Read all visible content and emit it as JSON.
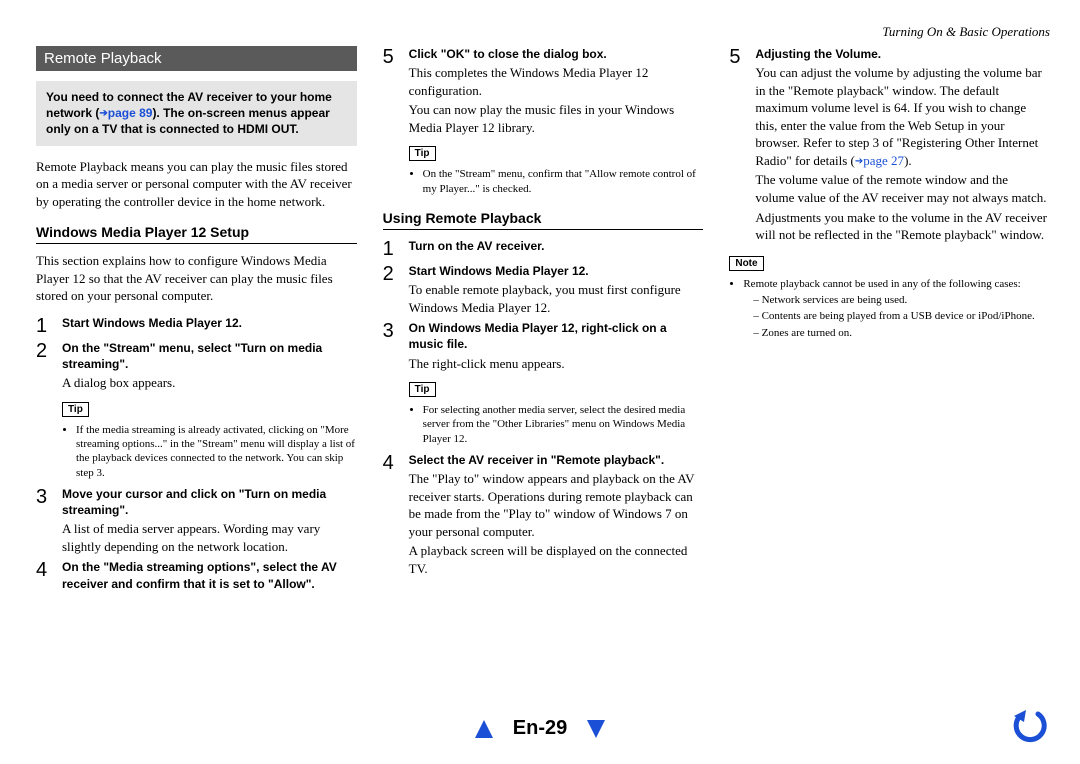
{
  "breadcrumb": "Turning On & Basic Operations",
  "section_title": "Remote Playback",
  "notice": {
    "part1": "You need to connect the AV receiver to your home network (",
    "link": "page 89",
    "part2": "). The on-screen menus appear only on a TV that is connected to ",
    "bold_end": "HDMI OUT",
    "tail": "."
  },
  "intro": "Remote Playback means you can play the music files stored on a media server or personal computer with the AV receiver by operating the controller device in the home network.",
  "wmp_heading": "Windows Media Player 12 Setup",
  "wmp_intro": "This section explains how to configure Windows Media Player 12 so that the AV receiver can play the music files stored on your personal computer.",
  "wmp_steps": {
    "s1": {
      "num": "1",
      "lead": "Start Windows Media Player 12."
    },
    "s2": {
      "num": "2",
      "lead": "On the \"Stream\" menu, select \"Turn on media streaming\".",
      "follow": "A dialog box appears."
    },
    "s2_tip_label": "Tip",
    "s2_tip_bullet": "If the media streaming is already activated, clicking on \"More streaming options...\" in the \"Stream\" menu will display a list of the playback devices connected to the network. You can skip step 3.",
    "s3": {
      "num": "3",
      "lead": "Move your cursor and click on \"Turn on media streaming\".",
      "follow": "A list of media server appears. Wording may vary slightly depending on the network location."
    },
    "s4": {
      "num": "4",
      "lead": "On the \"Media streaming options\", select the AV receiver and confirm that it is set to \"Allow\"."
    },
    "s5": {
      "num": "5",
      "lead": "Click \"OK\" to close the dialog box.",
      "follow": "This completes the Windows Media Player 12 configuration.",
      "follow2": "You can now play the music files in your Windows Media Player 12 library."
    },
    "s5_tip_label": "Tip",
    "s5_tip_bullet": "On the \"Stream\" menu, confirm that \"Allow remote control of my Player...\" is checked."
  },
  "remote_heading": "Using Remote Playback",
  "remote_steps": {
    "r1": {
      "num": "1",
      "lead": "Turn on the AV receiver."
    },
    "r2": {
      "num": "2",
      "lead": "Start Windows Media Player 12.",
      "follow": "To enable remote playback, you must first configure Windows Media Player 12."
    },
    "r3": {
      "num": "3",
      "lead": "On Windows Media Player 12, right-click on a music file.",
      "follow": "The right-click menu appears."
    },
    "r3_tip_label": "Tip",
    "r3_tip_bullet": "For selecting another media server, select the desired media server from the \"Other Libraries\" menu on Windows Media Player 12.",
    "r4": {
      "num": "4",
      "lead": "Select the AV receiver in \"Remote playback\".",
      "follow": "The \"Play to\" window appears and playback on the AV receiver starts. Operations during remote playback can be made from the \"Play to\" window of Windows 7 on your personal computer.",
      "follow2": "A playback screen will be displayed on the connected TV."
    },
    "r5": {
      "num": "5",
      "lead": "Adjusting the Volume.",
      "follow_a": "You can adjust the volume by adjusting the volume bar in the \"Remote playback\" window. The default maximum volume level is 64. If you wish to change this, enter the value from the Web Setup in your browser. Refer to step 3 of \"Registering Other Internet Radio\" for details (",
      "link": "page 27",
      "follow_a_tail": ").",
      "follow_b": "The volume value of the remote window and the volume value of the AV receiver may not always match.",
      "follow_c": "Adjustments you make to the volume in the AV receiver will not be reflected in the \"Remote playback\" window."
    }
  },
  "note_label": "Note",
  "note_bullet": "Remote playback cannot be used in any of the following cases:",
  "note_dashes": {
    "d1": "Network services are being used.",
    "d2": "Contents are being played from a USB device or iPod/iPhone.",
    "d3": "Zones are turned on."
  },
  "page_number": "En-29"
}
